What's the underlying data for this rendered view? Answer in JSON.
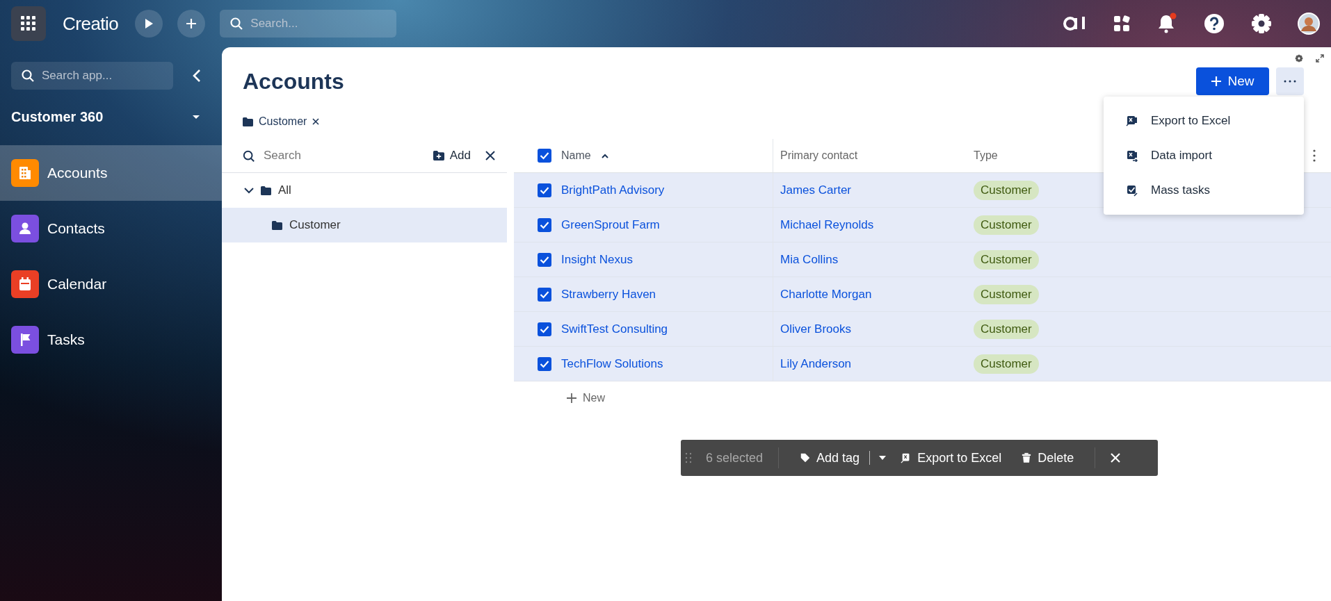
{
  "top_bar": {
    "logo": "Creatio",
    "search": {
      "placeholder": "Search..."
    },
    "notification_badge": true
  },
  "sidebar": {
    "search": {
      "placeholder": "Search app..."
    },
    "workspace": "Customer 360",
    "items": [
      {
        "label": "Accounts",
        "selected": true,
        "color": "#ff8a00"
      },
      {
        "label": "Contacts",
        "selected": false,
        "color": "#7b4fe0"
      },
      {
        "label": "Calendar",
        "selected": false,
        "color": "#ea3f25"
      },
      {
        "label": "Tasks",
        "selected": false,
        "color": "#7b4fe0"
      }
    ]
  },
  "page": {
    "title": "Accounts",
    "new_button": "New",
    "filter_chip": "Customer",
    "menu": [
      {
        "label": "Export to Excel"
      },
      {
        "label": "Data import"
      },
      {
        "label": "Mass tasks"
      }
    ]
  },
  "folders": {
    "search": {
      "placeholder": "Search"
    },
    "add_button": "Add",
    "tree": [
      {
        "label": "All",
        "expanded": true,
        "selected": false,
        "children": [
          {
            "label": "Customer",
            "selected": true
          }
        ]
      }
    ]
  },
  "grid": {
    "select_all": true,
    "columns": [
      {
        "label": "Name",
        "sorted": true
      },
      {
        "label": "Primary contact",
        "sorted": false
      },
      {
        "label": "Type",
        "sorted": false
      }
    ],
    "rows": [
      {
        "name": "BrightPath Advisory",
        "contact": "James Carter",
        "type": "Customer",
        "checked": true
      },
      {
        "name": "GreenSprout Farm",
        "contact": "Michael Reynolds",
        "type": "Customer",
        "checked": true
      },
      {
        "name": "Insight Nexus",
        "contact": "Mia Collins",
        "type": "Customer",
        "checked": true
      },
      {
        "name": "Strawberry Haven",
        "contact": "Charlotte Morgan",
        "type": "Customer",
        "checked": true
      },
      {
        "name": "SwiftTest Consulting",
        "contact": "Oliver Brooks",
        "type": "Customer",
        "checked": true
      },
      {
        "name": "TechFlow Solutions",
        "contact": "Lily Anderson",
        "type": "Customer",
        "checked": true
      }
    ],
    "new_row": "New"
  },
  "action_bar": {
    "count": "6 selected",
    "actions": [
      {
        "label": "Add tag"
      },
      {
        "label": "Export to Excel"
      },
      {
        "label": "Delete"
      }
    ]
  }
}
